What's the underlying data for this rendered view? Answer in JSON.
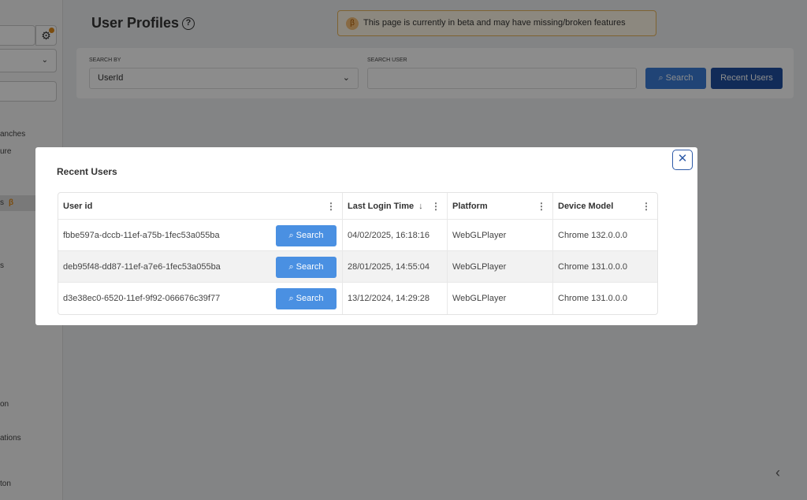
{
  "sidebar": {
    "items": [
      "anches",
      "ure",
      "s",
      "s",
      "on",
      "ations",
      "ton"
    ],
    "beta": "β"
  },
  "page": {
    "title": "User Profiles",
    "help": "?",
    "beta_icon": "β",
    "beta_notice": "This page is currently in beta and may have missing/broken features",
    "search_by_label": "SEARCH BY",
    "search_by_value": "UserId",
    "search_user_label": "SEARCH USER",
    "search_user_value": "",
    "search_btn": "Search",
    "recent_btn": "Recent Users"
  },
  "modal": {
    "title": "Recent Users",
    "close": "✕",
    "columns": [
      "User id",
      "Last Login Time",
      "Platform",
      "Device Model"
    ],
    "row_button": "Search",
    "rows": [
      {
        "user_id": "fbbe597a-dccb-11ef-a75b-1fec53a055ba",
        "last_login": "04/02/2025, 16:18:16",
        "platform": "WebGLPlayer",
        "device": "Chrome 132.0.0.0"
      },
      {
        "user_id": "deb95f48-dd87-11ef-a7e6-1fec53a055ba",
        "last_login": "28/01/2025, 14:55:04",
        "platform": "WebGLPlayer",
        "device": "Chrome 131.0.0.0"
      },
      {
        "user_id": "d3e38ec0-6520-11ef-9f92-066676c39f77",
        "last_login": "13/12/2024, 14:29:28",
        "platform": "WebGLPlayer",
        "device": "Chrome 131.0.0.0"
      }
    ]
  }
}
